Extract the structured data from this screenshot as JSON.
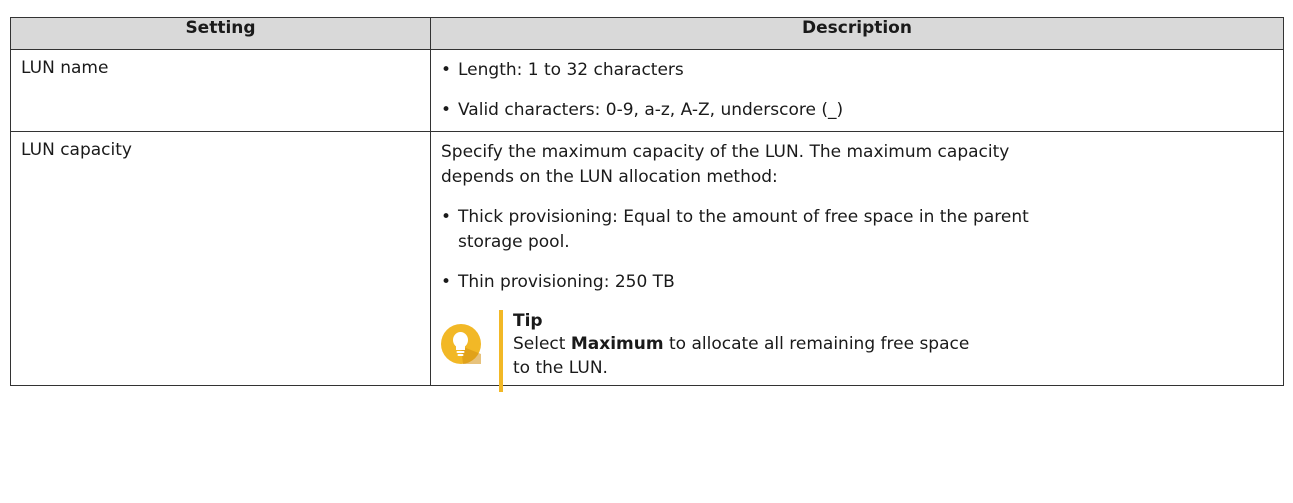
{
  "table": {
    "headers": [
      "Setting",
      "Description"
    ],
    "rows": [
      {
        "setting": "LUN name",
        "bullets": [
          "Length: 1 to 32 characters",
          "Valid characters: 0-9, a-z, A-Z, underscore (_)"
        ]
      },
      {
        "setting": "LUN capacity",
        "intro_line1": "Specify the maximum capacity of the LUN. The maximum capacity",
        "intro_line2": "depends on the LUN allocation method:",
        "bullets": [
          {
            "line1": "Thick provisioning: Equal to the amount of free space in the parent",
            "line2": "storage pool."
          },
          {
            "line1": "Thin provisioning: 250 TB"
          }
        ],
        "tip": {
          "title": "Tip",
          "text_before": "Select ",
          "text_bold": "Maximum",
          "text_after": " to allocate all remaining free space",
          "text_line2": "to the LUN.",
          "icon": "lightbulb-icon",
          "accent_color": "#f2b826"
        }
      }
    ]
  }
}
